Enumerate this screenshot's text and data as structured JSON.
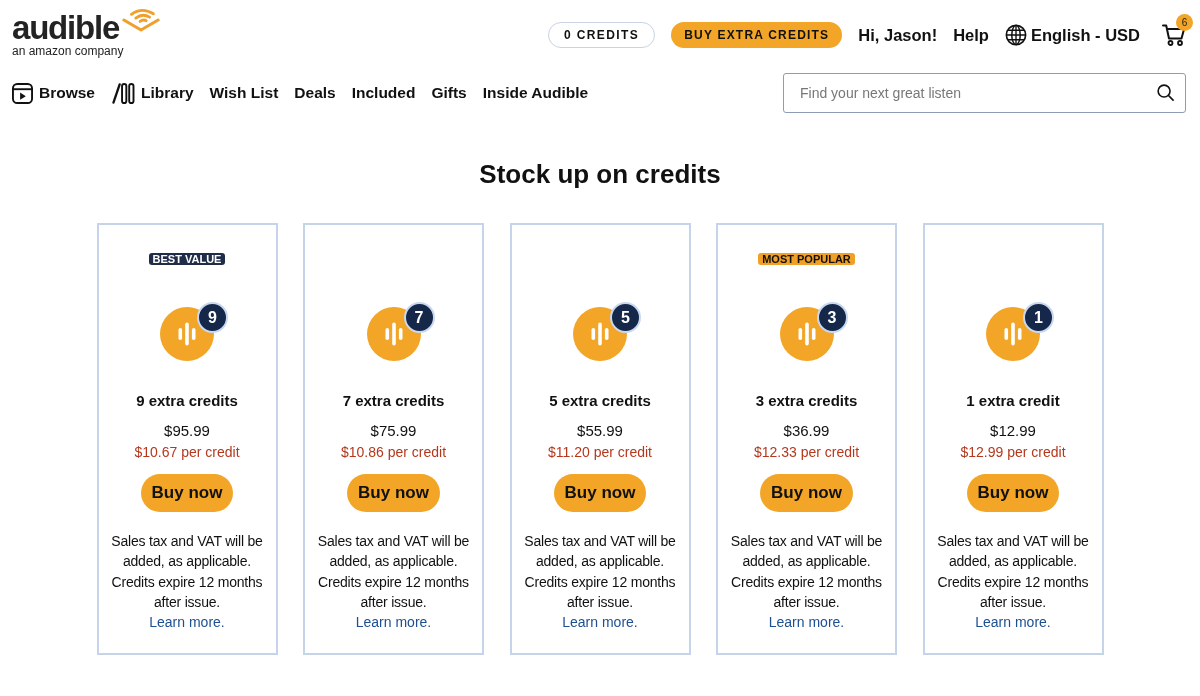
{
  "header": {
    "logo": {
      "wordmark": "audible",
      "tagline": "an amazon company"
    },
    "credits": "0 CREDITS",
    "buy_button": "BUY EXTRA CREDITS",
    "greeting": "Hi, Jason!",
    "help": "Help",
    "language": "English - USD",
    "cart_count": "6"
  },
  "nav": [
    {
      "label": "Browse",
      "kind": "browse"
    },
    {
      "label": "Library",
      "kind": "library"
    },
    {
      "label": "Wish List",
      "kind": "plain"
    },
    {
      "label": "Deals",
      "kind": "plain"
    },
    {
      "label": "Included",
      "kind": "plain"
    },
    {
      "label": "Gifts",
      "kind": "plain"
    },
    {
      "label": "Inside Audible",
      "kind": "plain"
    }
  ],
  "search": {
    "placeholder": "Find your next great listen"
  },
  "title": "Stock up on credits",
  "offers": [
    {
      "tag": {
        "text": "BEST VALUE",
        "color": "#1f2d48"
      },
      "badge": "9",
      "name": "9 extra credits",
      "price": "$95.99",
      "per_credit": "$10.67 per credit",
      "button": "Buy now",
      "note": "Sales tax and VAT will be added, as applicable. Credits expire 12 months after issue.",
      "link": "Learn more."
    },
    {
      "badge": "7",
      "name": "7 extra credits",
      "price": "$75.99",
      "per_credit": "$10.86 per credit",
      "button": "Buy now",
      "note": "Sales tax and VAT will be added, as applicable. Credits expire 12 months after issue.",
      "link": "Learn more."
    },
    {
      "badge": "5",
      "name": "5 extra credits",
      "price": "$55.99",
      "per_credit": "$11.20 per credit",
      "button": "Buy now",
      "note": "Sales tax and VAT will be added, as applicable. Credits expire 12 months after issue.",
      "link": "Learn more."
    },
    {
      "tag": {
        "text": "MOST POPULAR",
        "color": "#f0a027"
      },
      "badge": "3",
      "name": "3 extra credits",
      "price": "$36.99",
      "per_credit": "$12.33 per credit",
      "button": "Buy now",
      "note": "Sales tax and VAT will be added, as applicable. Credits expire 12 months after issue.",
      "link": "Learn more."
    },
    {
      "badge": "1",
      "name": "1 extra credit",
      "price": "$12.99",
      "per_credit": "$12.99 per credit",
      "button": "Buy now",
      "note": "Sales tax and VAT will be added, as applicable. Credits expire 12 months after issue.",
      "link": "Learn more."
    }
  ]
}
